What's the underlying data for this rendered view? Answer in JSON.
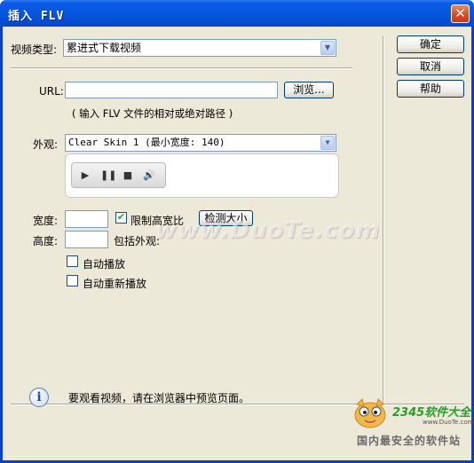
{
  "window": {
    "title": "插入 FLV",
    "close_glyph": "✕"
  },
  "form": {
    "video_type_label": "视频类型:",
    "video_type_value": "累进式下载视频",
    "url_label": "URL:",
    "url_value": "",
    "browse_label": "浏览...",
    "url_hint": "( 输入 FLV 文件的相对或绝对路径 )",
    "skin_label": "外观:",
    "skin_value": "Clear Skin 1 (最小宽度: 140)",
    "width_label": "宽度:",
    "width_value": "",
    "constrain_label": "限制高宽比",
    "constrain_checked": true,
    "detect_size_label": "检测大小",
    "height_label": "高度:",
    "height_value": "",
    "include_skin_label": "包括外观:",
    "autoplay_label": "自动播放",
    "autoplay_checked": false,
    "autorewind_label": "自动重新播放",
    "autorewind_checked": false
  },
  "side_buttons": {
    "ok": "确定",
    "cancel": "取消",
    "help": "帮助"
  },
  "info": {
    "icon": "info-icon",
    "text": "要观看视频，请在浏览器中预览页面。"
  },
  "player_controls": [
    "play-icon",
    "pause-icon",
    "stop-icon",
    "volume-icon"
  ],
  "watermark": {
    "text": "www.DuoTe.com"
  },
  "logo": {
    "brand": "2345软件大全",
    "url": "www.DuoTe.com",
    "slogan": "国内最安全的软件站"
  }
}
